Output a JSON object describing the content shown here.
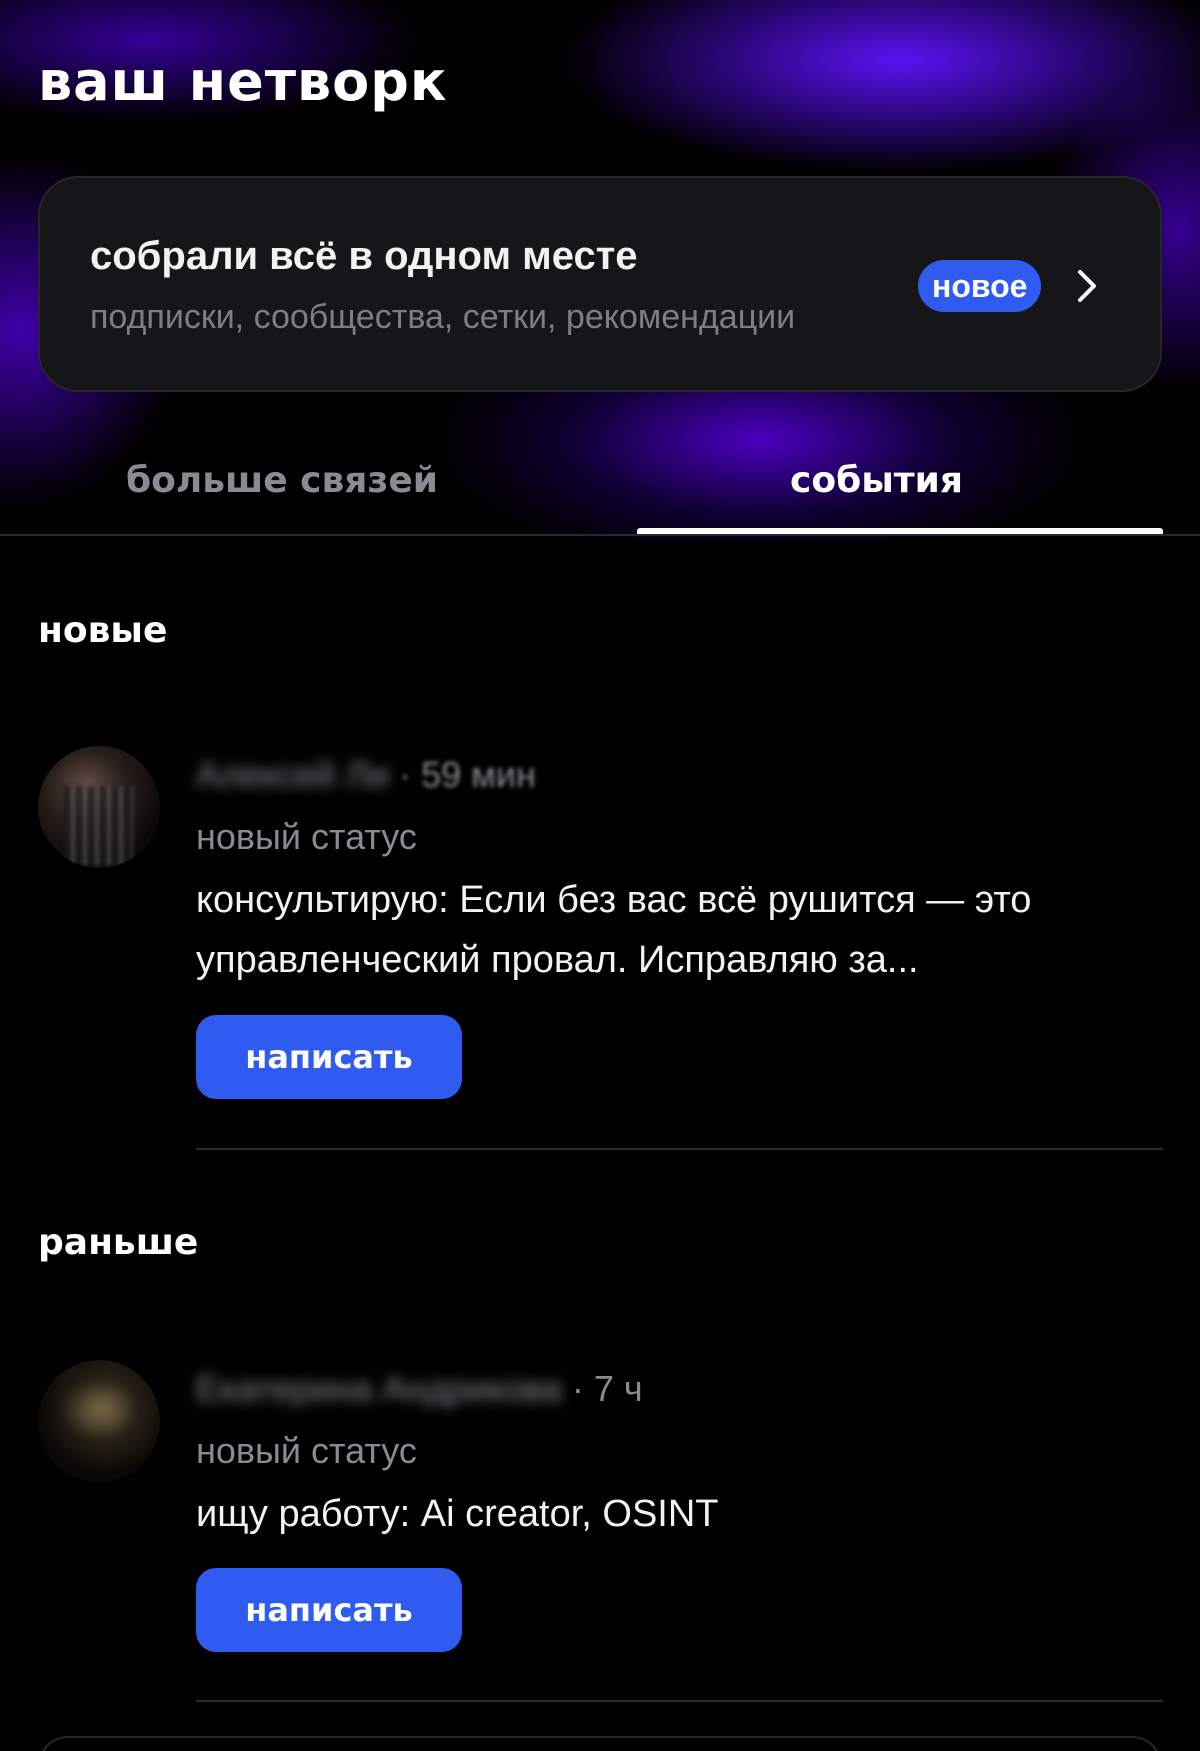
{
  "header": {
    "title": "ваш нетворк"
  },
  "promo": {
    "title": "собрали всё в одном месте",
    "subtitle": "подписки, сообщества, сетки, рекомендации",
    "badge": "новое"
  },
  "tabs": [
    {
      "label": "больше связей",
      "active": false
    },
    {
      "label": "события",
      "active": true
    }
  ],
  "sections": {
    "new": {
      "title": "новые",
      "items": [
        {
          "name": "Алексей Ли",
          "time": "59 мин",
          "type": "новый статус",
          "text": "консультирую: Если без вас всё рушится — это управленческий провал. Исправляю за...",
          "action": "написать"
        }
      ]
    },
    "earlier": {
      "title": "раньше",
      "items": [
        {
          "name": "Екатерина Андрикова",
          "time": "7 ч",
          "type": "новый статус",
          "text": "ищу работу: Ai creator, OSINT",
          "action": "написать"
        }
      ]
    }
  },
  "colors": {
    "accent": "#2f5bf0",
    "background": "#000000",
    "card": "#161618",
    "muted_text": "#8a8a90",
    "hero_glow": "#5f14ff"
  },
  "icons": {
    "promo_arrow": "chevron-right-icon"
  }
}
